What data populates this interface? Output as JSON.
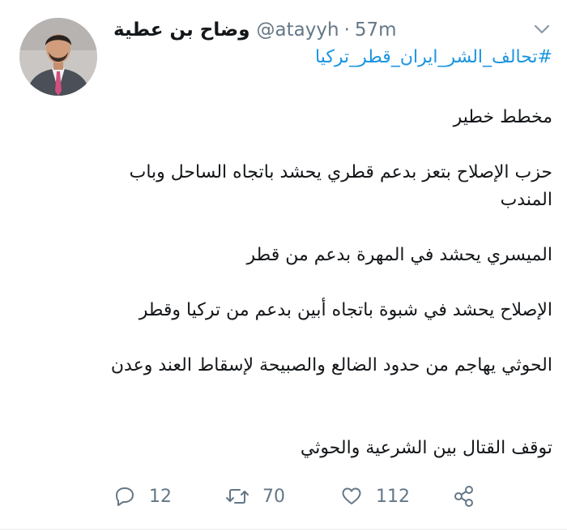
{
  "tweet": {
    "display_name": "وضاح بن عطية",
    "handle": "@atayyh",
    "separator": "·",
    "time": "57m",
    "hashtag": "#تحالف_الشر_ايران_قطر_تركيا",
    "paragraphs": [
      "مخطط خطير",
      "حزب الإصلاح بتعز بدعم قطري يحشد باتجاه الساحل وباب المندب",
      "الميسري يحشد في المهرة بدعم من قطر",
      "الإصلاح يحشد في شبوة باتجاه أبين بدعم من تركيا وقطر",
      "الحوثي يهاجم من حدود الضالع والصبيحة لإسقاط العند وعدن",
      "توقف القتال بين الشرعية والحوثي"
    ]
  },
  "actions": {
    "reply_count": "12",
    "retweet_count": "70",
    "like_count": "112"
  },
  "icons": {
    "avatar": "avatar",
    "more": "chevron-down-icon",
    "reply": "reply-icon",
    "retweet": "retweet-icon",
    "like": "heart-icon",
    "share": "share-icon"
  },
  "colors": {
    "text": "#14171a",
    "muted": "#657786",
    "link": "#1b95e0",
    "divider": "#e6ecf0"
  }
}
